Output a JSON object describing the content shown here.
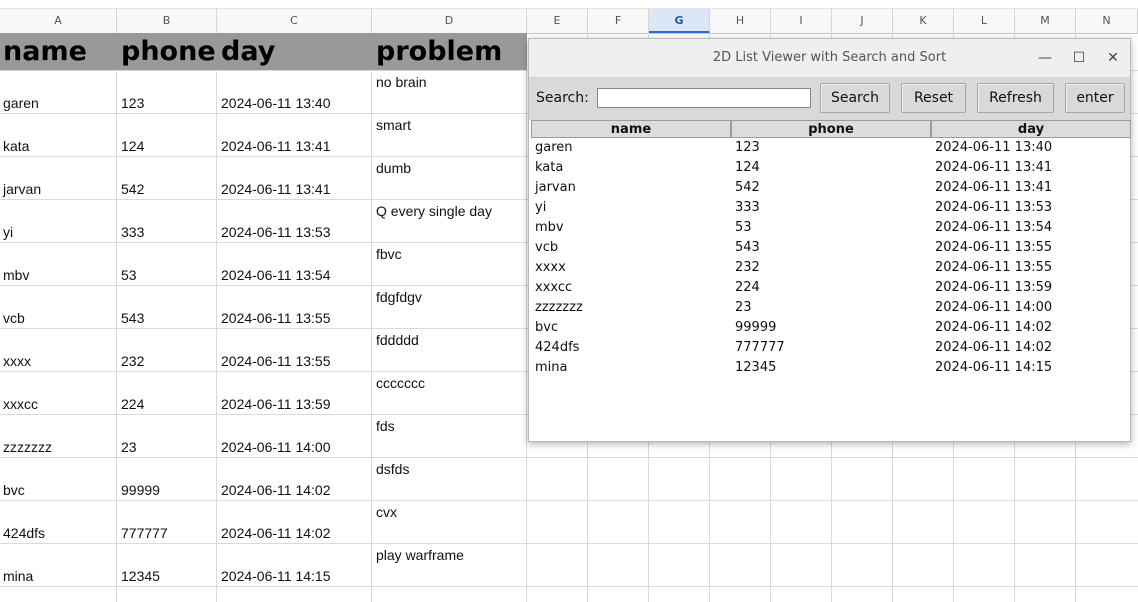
{
  "sheet": {
    "columns": [
      "A",
      "B",
      "C",
      "D",
      "E",
      "F",
      "G",
      "H",
      "I",
      "J",
      "K",
      "L",
      "M",
      "N"
    ],
    "active_column": "G",
    "header_row": [
      "name",
      "phone",
      "day",
      "problem"
    ],
    "rows": [
      {
        "name": "garen",
        "phone": "123",
        "day": "2024-06-11 13:40",
        "problem": "no brain"
      },
      {
        "name": "kata",
        "phone": "124",
        "day": "2024-06-11 13:41",
        "problem": "smart"
      },
      {
        "name": "jarvan",
        "phone": "542",
        "day": "2024-06-11 13:41",
        "problem": "dumb"
      },
      {
        "name": "yi",
        "phone": "333",
        "day": "2024-06-11 13:53",
        "problem": "Q every single day"
      },
      {
        "name": "mbv",
        "phone": "53",
        "day": "2024-06-11 13:54",
        "problem": "fbvc"
      },
      {
        "name": "vcb",
        "phone": "543",
        "day": "2024-06-11 13:55",
        "problem": "fdgfdgv"
      },
      {
        "name": "xxxx",
        "phone": "232",
        "day": "2024-06-11 13:55",
        "problem": "fddddd"
      },
      {
        "name": "xxxcc",
        "phone": "224",
        "day": "2024-06-11 13:59",
        "problem": "ccccccc"
      },
      {
        "name": "zzzzzzz",
        "phone": "23",
        "day": "2024-06-11 14:00",
        "problem": "fds"
      },
      {
        "name": "bvc",
        "phone": "99999",
        "day": "2024-06-11 14:02",
        "problem": "dsfds"
      },
      {
        "name": "424dfs",
        "phone": "777777",
        "day": "2024-06-11 14:02",
        "problem": "cvx"
      },
      {
        "name": "mina",
        "phone": "12345",
        "day": "2024-06-11 14:15",
        "problem": "play warframe"
      }
    ]
  },
  "viewer": {
    "title": "2D List Viewer with Search and Sort",
    "window_controls": {
      "minimize": "—",
      "maximize": "☐",
      "close": "✕"
    },
    "search_label": "Search:",
    "search_value": "",
    "buttons": {
      "search": "Search",
      "reset": "Reset",
      "refresh": "Refresh",
      "enter": "enter"
    },
    "list_columns": [
      "name",
      "phone",
      "day"
    ],
    "list_rows": [
      [
        "garen",
        "123",
        "2024-06-11 13:40"
      ],
      [
        "kata",
        "124",
        "2024-06-11 13:41"
      ],
      [
        "jarvan",
        "542",
        "2024-06-11 13:41"
      ],
      [
        "yi",
        "333",
        "2024-06-11 13:53"
      ],
      [
        "mbv",
        "53",
        "2024-06-11 13:54"
      ],
      [
        "vcb",
        "543",
        "2024-06-11 13:55"
      ],
      [
        "xxxx",
        "232",
        "2024-06-11 13:55"
      ],
      [
        "xxxcc",
        "224",
        "2024-06-11 13:59"
      ],
      [
        "zzzzzzz",
        "23",
        "2024-06-11 14:00"
      ],
      [
        "bvc",
        "99999",
        "2024-06-11 14:02"
      ],
      [
        "424dfs",
        "777777",
        "2024-06-11 14:02"
      ],
      [
        "mina",
        "12345",
        "2024-06-11 14:15"
      ]
    ]
  }
}
